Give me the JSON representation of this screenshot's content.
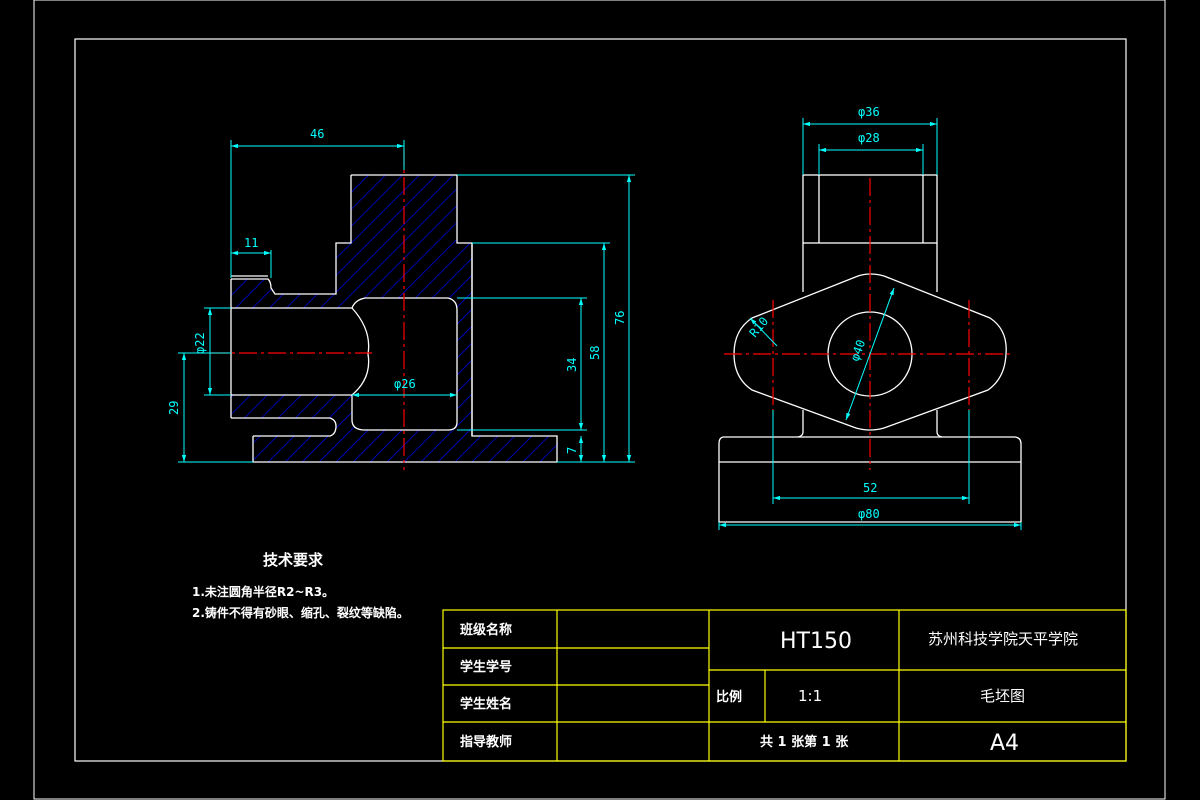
{
  "colors": {
    "background": "#000000",
    "outline": "#ffffff",
    "dimension": "#00ffff",
    "centerline": "#ff0000",
    "hatch": "#0000ff",
    "titleblock": "#ffff00"
  },
  "front_view": {
    "dimensions": {
      "d46": "46",
      "d11": "11",
      "d76": "76",
      "d58": "58",
      "d34": "34",
      "d7": "7",
      "d29": "29",
      "phi22": "φ22",
      "phi26": "φ26"
    }
  },
  "side_view": {
    "dimensions": {
      "phi36": "φ36",
      "phi28": "φ28",
      "r10": "R10",
      "phi40": "φ40",
      "d52": "52",
      "phi80": "φ80"
    }
  },
  "notes": {
    "title": "技术要求",
    "line1": "1.未注圆角半径R2~R3。",
    "line2": "2.铸件不得有砂眼、缩孔、裂纹等缺陷。"
  },
  "title_block": {
    "class_label": "班级名称",
    "student_id_label": "学生学号",
    "student_name_label": "学生姓名",
    "teacher_label": "指导教师",
    "material": "HT150",
    "school": "苏州科技学院天平学院",
    "scale_label": "比例",
    "scale_value": "1:1",
    "drawing_name": "毛坯图",
    "sheet_info": "共 1 张第 1 张",
    "paper_size": "A4"
  }
}
